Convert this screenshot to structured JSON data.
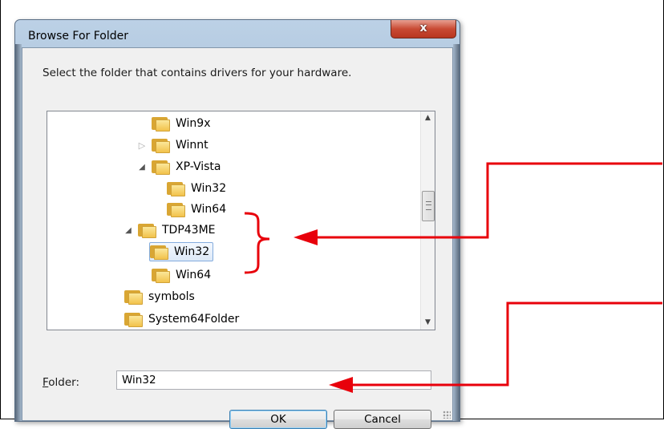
{
  "dialog": {
    "title": "Browse For Folder",
    "close_label": "x",
    "instruction": "Select the folder that contains drivers for your hardware."
  },
  "tree": {
    "items": [
      {
        "label": "Win9x",
        "toggle": ""
      },
      {
        "label": "Winnt",
        "toggle": "▷"
      },
      {
        "label": "XP-Vista",
        "toggle": "◢"
      },
      {
        "label": "Win32",
        "toggle": ""
      },
      {
        "label": "Win64",
        "toggle": ""
      },
      {
        "label": "TDP43ME",
        "toggle": "◢"
      },
      {
        "label": "Win32",
        "toggle": "",
        "selected": true
      },
      {
        "label": "Win64",
        "toggle": ""
      },
      {
        "label": "symbols",
        "toggle": ""
      },
      {
        "label": "System64Folder",
        "toggle": ""
      }
    ],
    "scroll_up": "▲",
    "scroll_down": "▼"
  },
  "folder_field": {
    "label_prefix": "",
    "label_accel": "F",
    "label_rest": "older:",
    "value": "Win32"
  },
  "buttons": {
    "ok": "OK",
    "cancel": "Cancel"
  },
  "colors": {
    "annotation_arrow": "#e8000b",
    "selection_border": "#84acdd",
    "ok_focus_border": "#3c7fb1"
  }
}
